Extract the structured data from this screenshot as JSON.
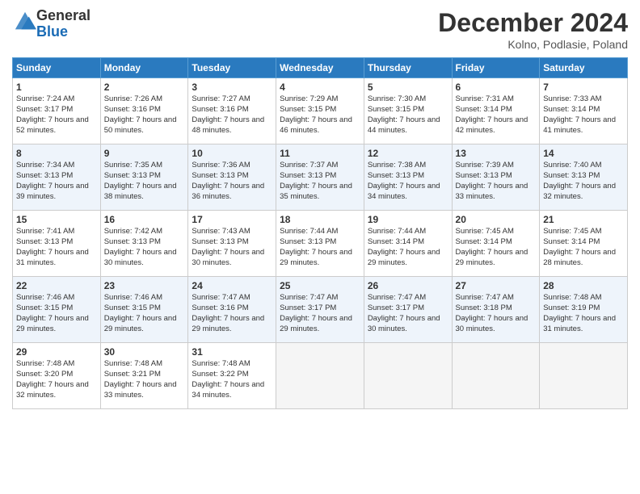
{
  "header": {
    "logo_general": "General",
    "logo_blue": "Blue",
    "main_title": "December 2024",
    "subtitle": "Kolno, Podlasie, Poland"
  },
  "calendar": {
    "headers": [
      "Sunday",
      "Monday",
      "Tuesday",
      "Wednesday",
      "Thursday",
      "Friday",
      "Saturday"
    ],
    "weeks": [
      [
        {
          "day": "",
          "empty": true
        },
        {
          "day": "",
          "empty": true
        },
        {
          "day": "",
          "empty": true
        },
        {
          "day": "",
          "empty": true
        },
        {
          "day": "",
          "empty": true
        },
        {
          "day": "",
          "empty": true
        },
        {
          "day": "1",
          "sunrise": "Sunrise: 7:24 AM",
          "sunset": "Sunset: 3:17 PM",
          "daylight": "Daylight: 7 hours and 52 minutes."
        }
      ],
      [
        {
          "day": "2",
          "sunrise": "Sunrise: 7:26 AM",
          "sunset": "Sunset: 3:16 PM",
          "daylight": "Daylight: 7 hours and 50 minutes."
        },
        {
          "day": "3",
          "sunrise": "Sunrise: 7:27 AM",
          "sunset": "Sunset: 3:16 PM",
          "daylight": "Daylight: 7 hours and 48 minutes."
        },
        {
          "day": "4",
          "sunrise": "Sunrise: 7:29 AM",
          "sunset": "Sunset: 3:15 PM",
          "daylight": "Daylight: 7 hours and 46 minutes."
        },
        {
          "day": "5",
          "sunrise": "Sunrise: 7:30 AM",
          "sunset": "Sunset: 3:15 PM",
          "daylight": "Daylight: 7 hours and 44 minutes."
        },
        {
          "day": "6",
          "sunrise": "Sunrise: 7:31 AM",
          "sunset": "Sunset: 3:14 PM",
          "daylight": "Daylight: 7 hours and 42 minutes."
        },
        {
          "day": "7",
          "sunrise": "Sunrise: 7:33 AM",
          "sunset": "Sunset: 3:14 PM",
          "daylight": "Daylight: 7 hours and 41 minutes."
        }
      ],
      [
        {
          "day": "8",
          "sunrise": "Sunrise: 7:34 AM",
          "sunset": "Sunset: 3:13 PM",
          "daylight": "Daylight: 7 hours and 39 minutes."
        },
        {
          "day": "9",
          "sunrise": "Sunrise: 7:35 AM",
          "sunset": "Sunset: 3:13 PM",
          "daylight": "Daylight: 7 hours and 38 minutes."
        },
        {
          "day": "10",
          "sunrise": "Sunrise: 7:36 AM",
          "sunset": "Sunset: 3:13 PM",
          "daylight": "Daylight: 7 hours and 36 minutes."
        },
        {
          "day": "11",
          "sunrise": "Sunrise: 7:37 AM",
          "sunset": "Sunset: 3:13 PM",
          "daylight": "Daylight: 7 hours and 35 minutes."
        },
        {
          "day": "12",
          "sunrise": "Sunrise: 7:38 AM",
          "sunset": "Sunset: 3:13 PM",
          "daylight": "Daylight: 7 hours and 34 minutes."
        },
        {
          "day": "13",
          "sunrise": "Sunrise: 7:39 AM",
          "sunset": "Sunset: 3:13 PM",
          "daylight": "Daylight: 7 hours and 33 minutes."
        },
        {
          "day": "14",
          "sunrise": "Sunrise: 7:40 AM",
          "sunset": "Sunset: 3:13 PM",
          "daylight": "Daylight: 7 hours and 32 minutes."
        }
      ],
      [
        {
          "day": "15",
          "sunrise": "Sunrise: 7:41 AM",
          "sunset": "Sunset: 3:13 PM",
          "daylight": "Daylight: 7 hours and 31 minutes."
        },
        {
          "day": "16",
          "sunrise": "Sunrise: 7:42 AM",
          "sunset": "Sunset: 3:13 PM",
          "daylight": "Daylight: 7 hours and 30 minutes."
        },
        {
          "day": "17",
          "sunrise": "Sunrise: 7:43 AM",
          "sunset": "Sunset: 3:13 PM",
          "daylight": "Daylight: 7 hours and 30 minutes."
        },
        {
          "day": "18",
          "sunrise": "Sunrise: 7:44 AM",
          "sunset": "Sunset: 3:13 PM",
          "daylight": "Daylight: 7 hours and 29 minutes."
        },
        {
          "day": "19",
          "sunrise": "Sunrise: 7:44 AM",
          "sunset": "Sunset: 3:14 PM",
          "daylight": "Daylight: 7 hours and 29 minutes."
        },
        {
          "day": "20",
          "sunrise": "Sunrise: 7:45 AM",
          "sunset": "Sunset: 3:14 PM",
          "daylight": "Daylight: 7 hours and 29 minutes."
        },
        {
          "day": "21",
          "sunrise": "Sunrise: 7:45 AM",
          "sunset": "Sunset: 3:14 PM",
          "daylight": "Daylight: 7 hours and 28 minutes."
        }
      ],
      [
        {
          "day": "22",
          "sunrise": "Sunrise: 7:46 AM",
          "sunset": "Sunset: 3:15 PM",
          "daylight": "Daylight: 7 hours and 29 minutes."
        },
        {
          "day": "23",
          "sunrise": "Sunrise: 7:46 AM",
          "sunset": "Sunset: 3:15 PM",
          "daylight": "Daylight: 7 hours and 29 minutes."
        },
        {
          "day": "24",
          "sunrise": "Sunrise: 7:47 AM",
          "sunset": "Sunset: 3:16 PM",
          "daylight": "Daylight: 7 hours and 29 minutes."
        },
        {
          "day": "25",
          "sunrise": "Sunrise: 7:47 AM",
          "sunset": "Sunset: 3:17 PM",
          "daylight": "Daylight: 7 hours and 29 minutes."
        },
        {
          "day": "26",
          "sunrise": "Sunrise: 7:47 AM",
          "sunset": "Sunset: 3:17 PM",
          "daylight": "Daylight: 7 hours and 30 minutes."
        },
        {
          "day": "27",
          "sunrise": "Sunrise: 7:47 AM",
          "sunset": "Sunset: 3:18 PM",
          "daylight": "Daylight: 7 hours and 30 minutes."
        },
        {
          "day": "28",
          "sunrise": "Sunrise: 7:48 AM",
          "sunset": "Sunset: 3:19 PM",
          "daylight": "Daylight: 7 hours and 31 minutes."
        }
      ],
      [
        {
          "day": "29",
          "sunrise": "Sunrise: 7:48 AM",
          "sunset": "Sunset: 3:20 PM",
          "daylight": "Daylight: 7 hours and 32 minutes."
        },
        {
          "day": "30",
          "sunrise": "Sunrise: 7:48 AM",
          "sunset": "Sunset: 3:21 PM",
          "daylight": "Daylight: 7 hours and 33 minutes."
        },
        {
          "day": "31",
          "sunrise": "Sunrise: 7:48 AM",
          "sunset": "Sunset: 3:22 PM",
          "daylight": "Daylight: 7 hours and 34 minutes."
        },
        {
          "day": "",
          "empty": true
        },
        {
          "day": "",
          "empty": true
        },
        {
          "day": "",
          "empty": true
        },
        {
          "day": "",
          "empty": true
        }
      ]
    ]
  }
}
